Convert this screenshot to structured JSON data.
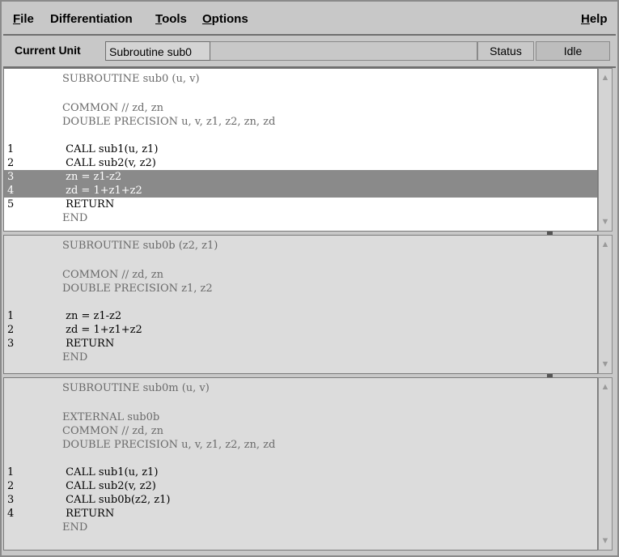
{
  "menu": {
    "file": "File",
    "differentiation": "Differentiation",
    "tools": "Tools",
    "options": "Options",
    "help": "Help"
  },
  "unit": {
    "label": "Current Unit",
    "value": "Subroutine sub0",
    "status_label": "Status",
    "status_value": "Idle"
  },
  "panes": [
    {
      "lines": [
        {
          "num": "",
          "code": "SUBROUTINE sub0 (u, v)",
          "style": "dim"
        },
        {
          "num": "",
          "code": "",
          "style": "dim"
        },
        {
          "num": "",
          "code": "COMMON // zd, zn",
          "style": "dim"
        },
        {
          "num": "",
          "code": "DOUBLE PRECISION u, v, z1, z2, zn, zd",
          "style": "dim"
        },
        {
          "num": "",
          "code": "",
          "style": "dim"
        },
        {
          "num": "1",
          "code": " CALL sub1(u, z1)",
          "style": ""
        },
        {
          "num": "2",
          "code": " CALL sub2(v, z2)",
          "style": ""
        },
        {
          "num": "3",
          "code": " zn = z1-z2",
          "style": "hl"
        },
        {
          "num": "4",
          "code": " zd = 1+z1+z2",
          "style": "hl"
        },
        {
          "num": "5",
          "code": " RETURN",
          "style": ""
        },
        {
          "num": "",
          "code": "END",
          "style": "dim"
        }
      ]
    },
    {
      "lines": [
        {
          "num": "",
          "code": "SUBROUTINE sub0b (z2, z1)",
          "style": "dim"
        },
        {
          "num": "",
          "code": "",
          "style": "dim"
        },
        {
          "num": "",
          "code": "COMMON // zd, zn",
          "style": "dim"
        },
        {
          "num": "",
          "code": "DOUBLE PRECISION z1, z2",
          "style": "dim"
        },
        {
          "num": "",
          "code": "",
          "style": "dim"
        },
        {
          "num": "1",
          "code": " zn = z1-z2",
          "style": ""
        },
        {
          "num": "2",
          "code": " zd = 1+z1+z2",
          "style": ""
        },
        {
          "num": "3",
          "code": " RETURN",
          "style": ""
        },
        {
          "num": "",
          "code": "END",
          "style": "dim"
        }
      ]
    },
    {
      "lines": [
        {
          "num": "",
          "code": "SUBROUTINE sub0m (u, v)",
          "style": "dim"
        },
        {
          "num": "",
          "code": "",
          "style": "dim"
        },
        {
          "num": "",
          "code": "EXTERNAL sub0b",
          "style": "dim"
        },
        {
          "num": "",
          "code": "COMMON // zd, zn",
          "style": "dim"
        },
        {
          "num": "",
          "code": "DOUBLE PRECISION u, v, z1, z2, zn, zd",
          "style": "dim"
        },
        {
          "num": "",
          "code": "",
          "style": "dim"
        },
        {
          "num": "1",
          "code": " CALL sub1(u, z1)",
          "style": ""
        },
        {
          "num": "2",
          "code": " CALL sub2(v, z2)",
          "style": ""
        },
        {
          "num": "3",
          "code": " CALL sub0b(z2, z1)",
          "style": ""
        },
        {
          "num": "4",
          "code": " RETURN",
          "style": ""
        },
        {
          "num": "",
          "code": "END",
          "style": "dim"
        }
      ]
    }
  ],
  "icons": {
    "scroll_up": "scroll-up-arrow-icon",
    "scroll_down": "scroll-down-arrow-icon"
  },
  "colors": {
    "highlight": "#8a8a8a",
    "pane_bg_active": "#ffffff",
    "pane_bg_inactive": "#dcdcdc",
    "window_bg": "#c8c8c8"
  }
}
